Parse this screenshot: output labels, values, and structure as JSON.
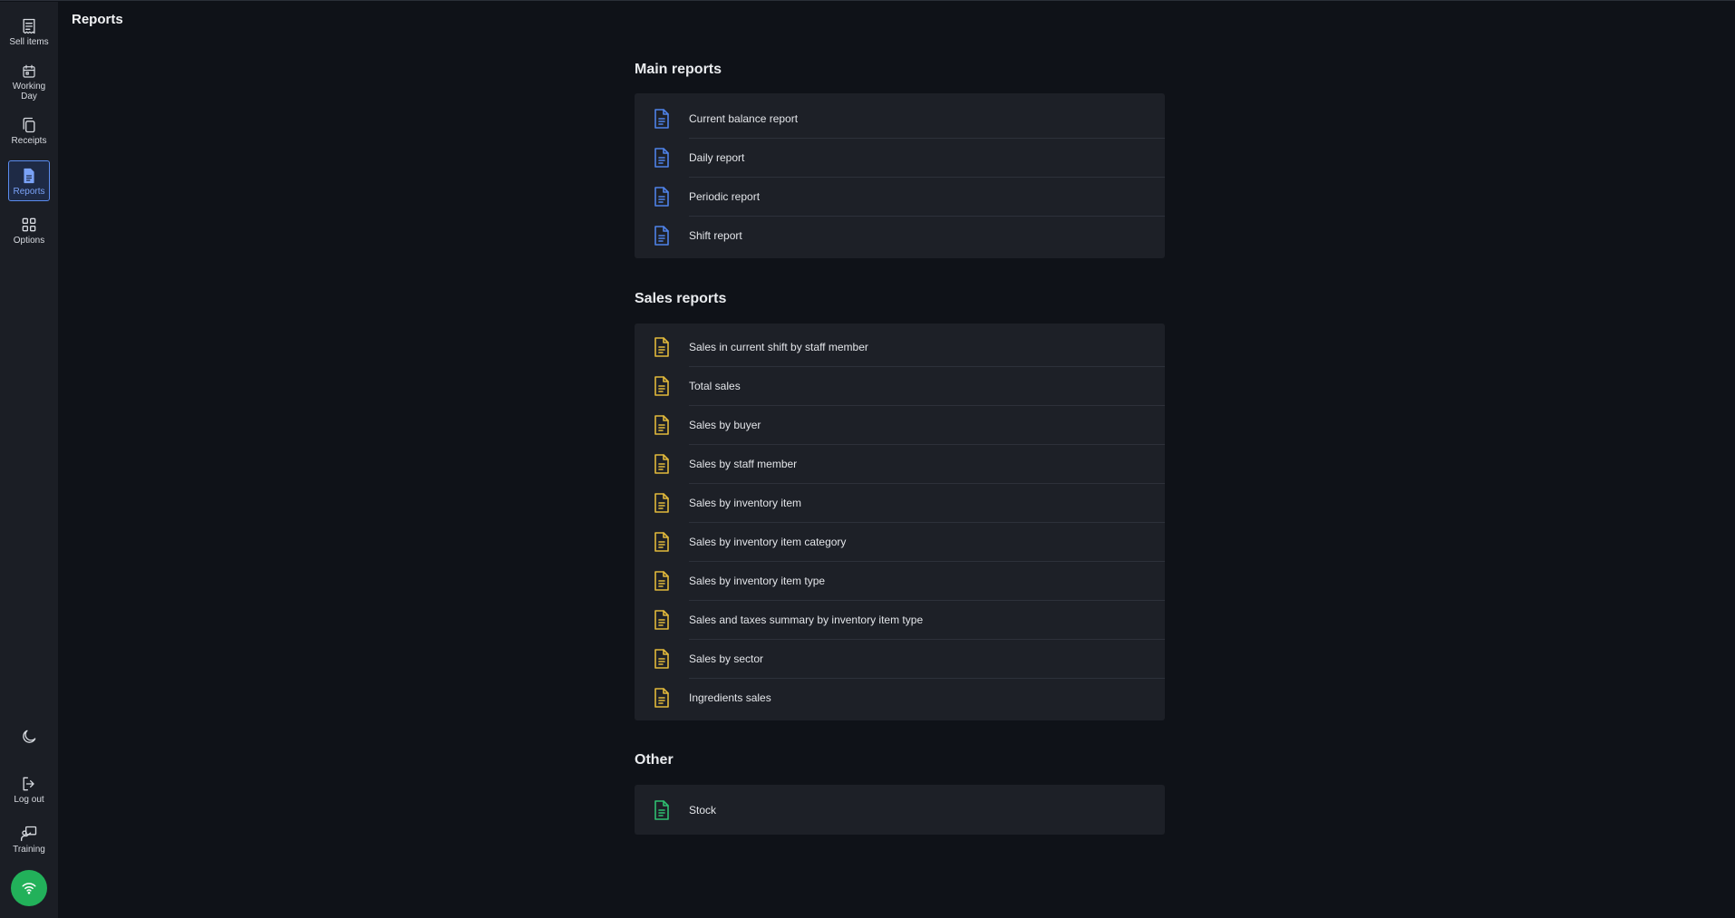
{
  "page_title": "Reports",
  "sidebar": {
    "items": [
      {
        "label": "Sell items",
        "icon": "receipt-list-icon"
      },
      {
        "label": "Working Day",
        "icon": "calendar-icon"
      },
      {
        "label": "Receipts",
        "icon": "copy-icon"
      },
      {
        "label": "Reports",
        "icon": "file-text-icon",
        "active": true
      },
      {
        "label": "Options",
        "icon": "grid-icon"
      }
    ],
    "bottom": [
      {
        "label": "",
        "icon": "moon-icon"
      },
      {
        "label": "Log out",
        "icon": "log-out-icon"
      },
      {
        "label": "Training",
        "icon": "training-icon"
      },
      {
        "label": "",
        "icon": "wifi-icon"
      }
    ]
  },
  "colors": {
    "main_reports": "#4f82e8",
    "sales_reports": "#e2b93b",
    "other": "#2fbf71",
    "active_nav": "#7aa2f7",
    "wifi": "#22b15a"
  },
  "sections": [
    {
      "title": "Main reports",
      "items": [
        "Current balance report",
        "Daily report",
        "Periodic report",
        "Shift report"
      ]
    },
    {
      "title": "Sales reports",
      "items": [
        "Sales in current shift by staff member",
        "Total sales",
        "Sales by buyer",
        "Sales by staff member",
        "Sales by inventory item",
        "Sales by inventory item category",
        "Sales by inventory item type",
        "Sales and taxes summary by inventory item type",
        "Sales by sector",
        "Ingredients sales"
      ]
    },
    {
      "title": "Other",
      "items": [
        "Stock"
      ]
    }
  ]
}
